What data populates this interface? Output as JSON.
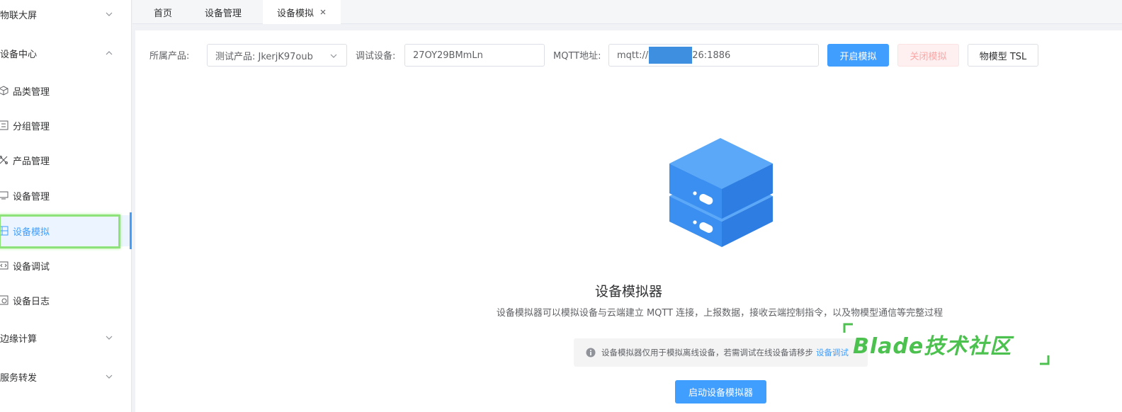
{
  "sidebar": {
    "groups": [
      {
        "label": "物联大屏"
      },
      {
        "label": "设备中心"
      },
      {
        "label": "边缘计算"
      },
      {
        "label": "服务转发"
      }
    ],
    "items": [
      {
        "label": "品类管理",
        "icon": "cube-icon"
      },
      {
        "label": "分组管理",
        "icon": "group-icon"
      },
      {
        "label": "产品管理",
        "icon": "product-icon"
      },
      {
        "label": "设备管理",
        "icon": "monitor-icon"
      },
      {
        "label": "设备模拟",
        "icon": "simulate-icon"
      },
      {
        "label": "设备调试",
        "icon": "debug-icon"
      },
      {
        "label": "设备日志",
        "icon": "log-icon"
      }
    ],
    "active_item": "设备模拟"
  },
  "tabs": [
    {
      "label": "首页"
    },
    {
      "label": "设备管理"
    },
    {
      "label": "设备模拟",
      "closable": true
    }
  ],
  "toolbar": {
    "product_label": "所属产品:",
    "product_value": "测试产品: JkerjK97oub",
    "device_label": "调试设备:",
    "device_value": "27OY29BMmLn",
    "mqtt_label": "MQTT地址:",
    "mqtt_prefix": "mqtt://",
    "mqtt_suffix": "26:1886",
    "start_sim": "开启模拟",
    "stop_sim": "关闭模拟",
    "tsl": "物模型 TSL"
  },
  "empty_state": {
    "title": "设备模拟器",
    "description": "设备模拟器可以模拟设备与云端建立 MQTT 连接，上报数据，接收云端控制指令，以及物模型通信等完整过程",
    "notice_text": "设备模拟器仅用于模拟离线设备，若需调试在线设备请移步",
    "notice_link": "设备调试",
    "start_button": "启动设备模拟器"
  },
  "watermark": {
    "text": "Blade技术社区"
  },
  "colors": {
    "primary": "#409eff",
    "active_bg": "#ecf5ff",
    "highlight": "#8ee27a",
    "watermark": "#4cc14f"
  }
}
